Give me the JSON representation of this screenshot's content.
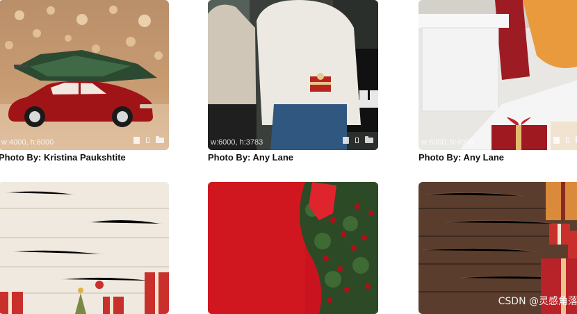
{
  "gallery": {
    "items": [
      {
        "dimensions": "w:4000, h:6000",
        "credit": "Photo By: Kristina Paukshtite"
      },
      {
        "dimensions": "w:6000, h:3783",
        "credit": "Photo By: Any Lane"
      },
      {
        "dimensions": "w:6000, h:4000",
        "credit": "Photo By: Any Lane"
      },
      {
        "dimensions": "",
        "credit": ""
      },
      {
        "dimensions": "",
        "credit": ""
      },
      {
        "dimensions": "",
        "credit": ""
      }
    ],
    "icons": [
      "clipboard-icon",
      "bookmark-icon",
      "folder-icon"
    ]
  },
  "watermark": "CSDN @灵感角落"
}
